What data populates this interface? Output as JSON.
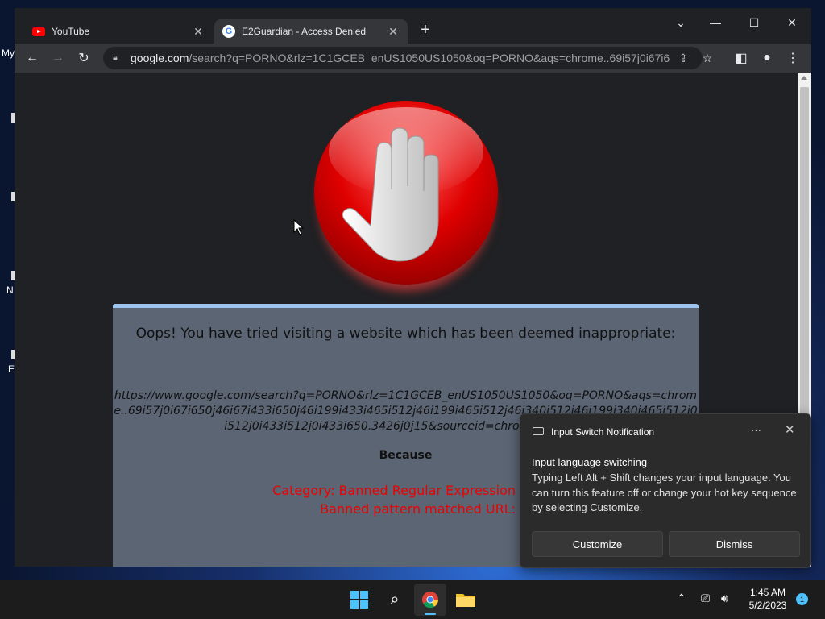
{
  "desktop": {
    "labels": [
      "My",
      "N",
      "E"
    ]
  },
  "browser": {
    "tabs": [
      {
        "title": "YouTube",
        "icon": "youtube-icon"
      },
      {
        "title": "E2Guardian - Access Denied",
        "icon": "google-icon"
      }
    ],
    "new_tab": "+",
    "url_host": "google.com",
    "url_rest": "/search?q=PORNO&rlz=1C1GCEB_enUS1050US1050&oq=PORNO&aqs=chrome..69i57j0i67i6..."
  },
  "page": {
    "title": "Oops! You have tried visiting a website which has been deemed inappropriate:",
    "blocked_url": "https://www.google.com/search?q=PORNO&rlz=1C1GCEB_enUS1050US1050&oq=PORNO&aqs=chrome..69i57j0i67i650j46i67i433i650j46i199i433i465i512j46i199i465i512j46i340i512j46i199i340i465i512i0i512j0i433i512j0i433i650.3426j0j15&sourceid=chrome&ie=UTF",
    "because": "Because",
    "reason_line1": "Category: Banned Regular Expression",
    "reason_line2": "Banned pattern matched URL:"
  },
  "notification": {
    "app": "Input Switch Notification",
    "more": "···",
    "heading": "Input language switching",
    "body": "Typing Left Alt + Shift changes your input language. You can turn this feature off or change your hot key sequence by selecting Customize.",
    "customize": "Customize",
    "dismiss": "Dismiss"
  },
  "taskbar": {
    "time": "1:45 AM",
    "date": "5/2/2023",
    "badge": "1"
  },
  "colors": {
    "accent": "#4cc2ff",
    "banner": "#9cc4ee",
    "reason": "#ee0000"
  }
}
